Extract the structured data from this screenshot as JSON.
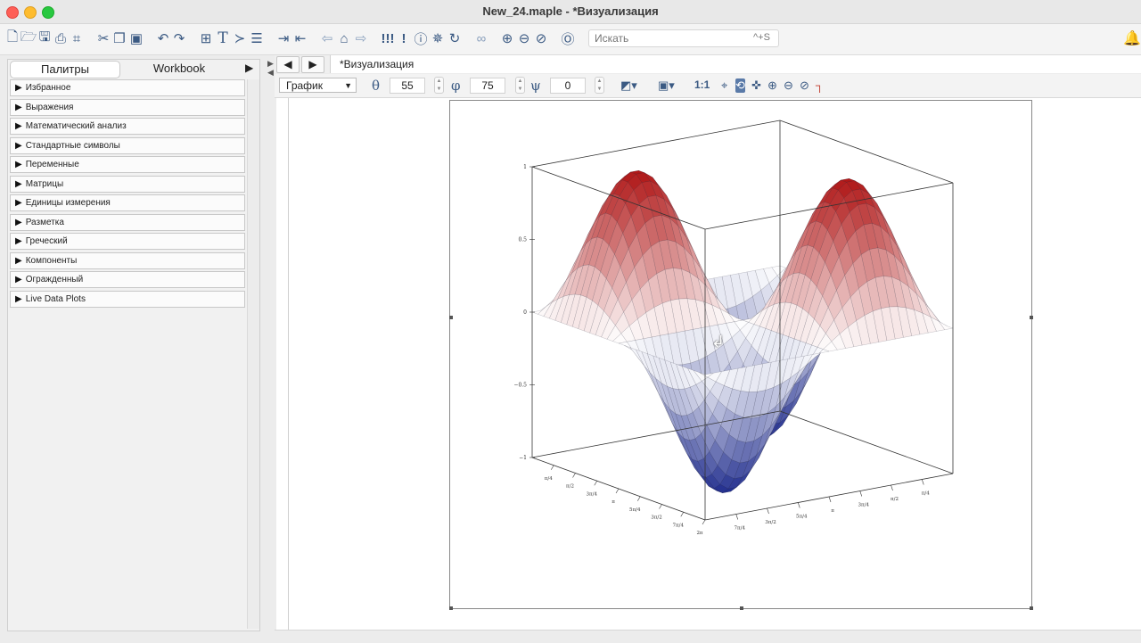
{
  "window": {
    "title": "New_24.maple - *Визуализация"
  },
  "toolbar": {
    "icons": [
      "new-document-icon",
      "open-icon",
      "save-icon",
      "print-icon",
      "print-preview-icon",
      "cut-icon",
      "copy-icon",
      "paste-icon",
      "undo-icon",
      "redo-icon",
      "math-mode-icon",
      "text-mode-icon",
      "prompt-icon",
      "paragraph-icon",
      "indent-icon",
      "outdent-icon",
      "back-icon",
      "home-icon",
      "forward-icon",
      "execute-all-icon",
      "execute-icon",
      "stop-icon",
      "debug-icon",
      "restart-icon",
      "link-icon",
      "zoom-in-icon",
      "zoom-out-icon",
      "zoom-reset-icon",
      "help-icon"
    ],
    "search_placeholder": "Искать",
    "search_shortcut": "^+S"
  },
  "palettes": {
    "tab_active": "Палитры",
    "tab_inactive": "Workbook",
    "items": [
      "Избранное",
      "Выражения",
      "Математический анализ",
      "Стандартные символы",
      "Переменные",
      "Матрицы",
      "Единицы измерения",
      "Разметка",
      "Греческий",
      "Компоненты",
      "Огражденный",
      "Live Data Plots"
    ]
  },
  "document": {
    "tab_title": "*Визуализация"
  },
  "plot_toolbar": {
    "type_selected": "График",
    "theta_symbol": "θ",
    "theta": "55",
    "phi_symbol": "φ",
    "phi": "75",
    "psi_symbol": "ψ",
    "psi": "0",
    "scale_label": "1:1"
  },
  "plot": {
    "z_ticks": [
      "1",
      "0.5",
      "0",
      "−0.5",
      "−1"
    ],
    "x_ticks": [
      "π/4",
      "π/2",
      "3π/4",
      "π",
      "5π/4",
      "3π/2",
      "7π/4",
      "2π"
    ],
    "y_ticks": [
      "7π/4",
      "3π/2",
      "5π/4",
      "π",
      "3π/4",
      "π/2",
      "π/4"
    ],
    "accent_colors": {
      "surface_low": "#1d2a8c",
      "surface_mid": "#ffffff",
      "surface_high": "#b01818"
    }
  }
}
